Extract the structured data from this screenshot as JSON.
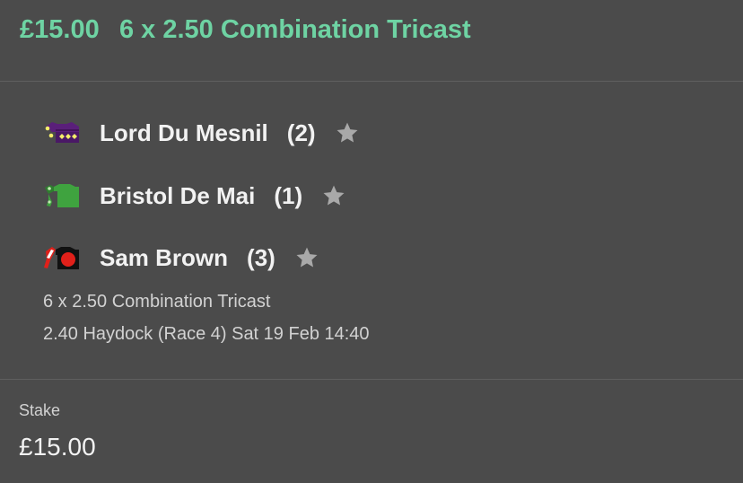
{
  "header": {
    "amount": "£15.00",
    "title": "6 x 2.50 Combination Tricast",
    "accent_color": "#6ed3a3"
  },
  "runners": [
    {
      "name": "Lord Du Mesnil",
      "position": "(2)",
      "silk_icon": "silk-purple-icon",
      "silk_color": "#5a1f7a",
      "favourite_icon": "star-icon"
    },
    {
      "name": "Bristol De Mai",
      "position": "(1)",
      "silk_icon": "silk-green-icon",
      "silk_color": "#3fa33f",
      "favourite_icon": "star-icon"
    },
    {
      "name": "Sam Brown",
      "position": "(3)",
      "silk_icon": "silk-red-black-icon",
      "silk_color": "#e0201a",
      "favourite_icon": "star-icon"
    }
  ],
  "bet": {
    "description": "6 x 2.50 Combination Tricast",
    "event": "2.40 Haydock (Race 4) Sat 19 Feb 14:40"
  },
  "stake": {
    "label": "Stake",
    "value": "£15.00"
  }
}
